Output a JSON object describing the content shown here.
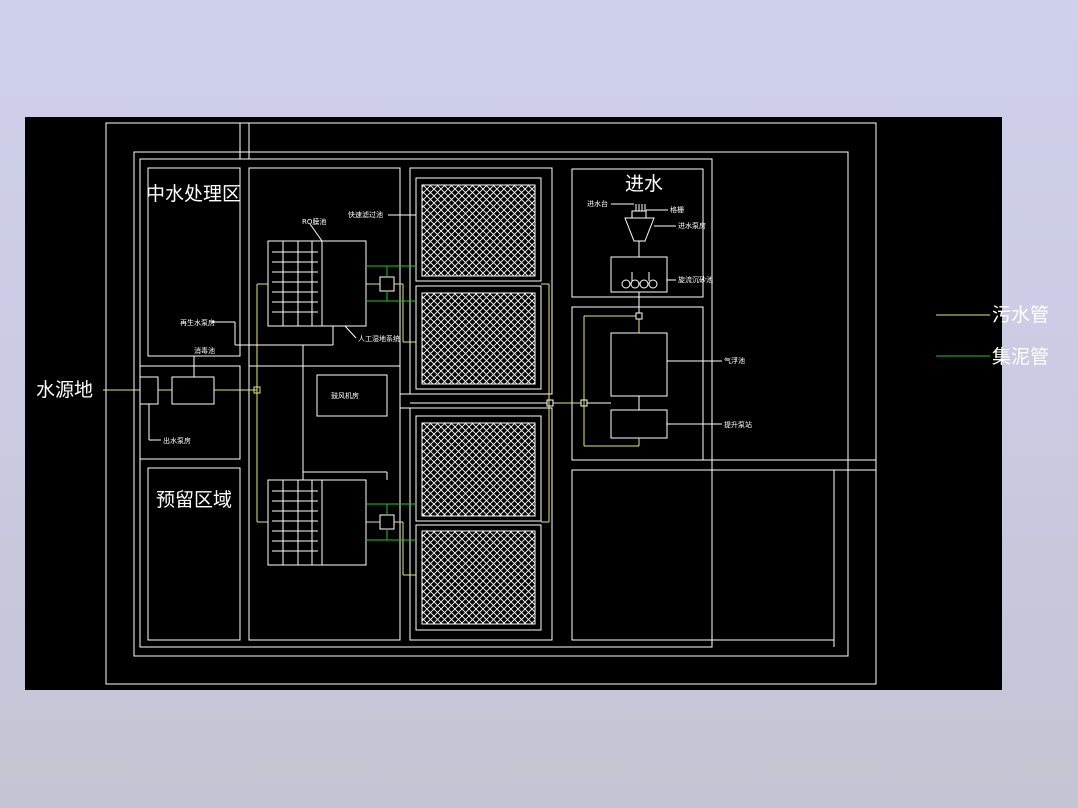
{
  "colors": {
    "canvas": "#000000",
    "line": "#ffffff",
    "sewage_pipe": "#e6e67a",
    "sludge_pipe": "#27c02a"
  },
  "zones": {
    "reclaimed_water": "中水处理区",
    "reserved": "预留区域",
    "inlet": "进水",
    "water_source": "水源地"
  },
  "labels": {
    "ro_tank": "RO膜池",
    "rapid_filter": "快速滤过池",
    "inlet_well": "进水台",
    "screen": "格栅",
    "inlet_pump": "进水泵房",
    "grit_tank": "旋流沉砂池",
    "recycled_pump": "再生水泵房",
    "disinfection": "消毒池",
    "artificial_wetland": "人工湿地系统",
    "blower_room": "鼓风机房",
    "outlet_pump": "出水泵房",
    "aeration_tank": "气浮池",
    "lift_pump": "提升泵站"
  },
  "legend": {
    "sewage": "污水管",
    "sludge": "集泥管"
  }
}
